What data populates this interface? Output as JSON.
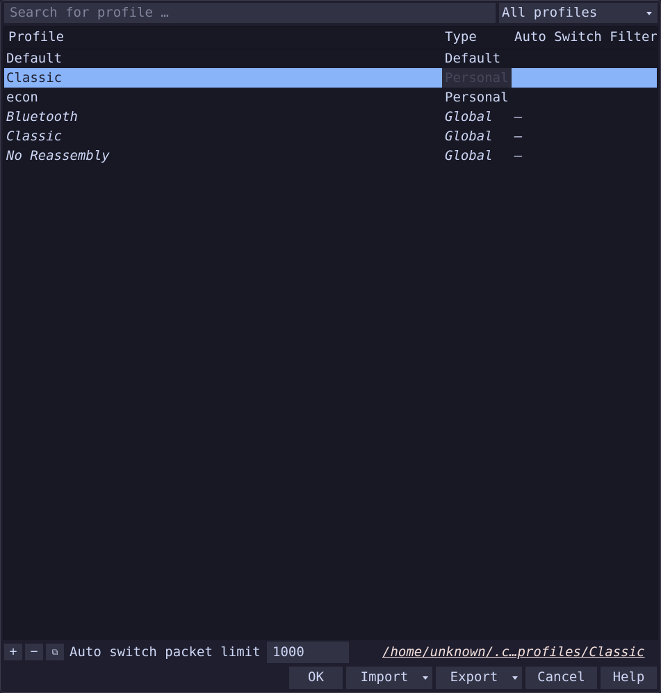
{
  "search": {
    "placeholder": "Search for profile …"
  },
  "filter_combo": {
    "selected": "All profiles"
  },
  "table": {
    "columns": [
      "Profile",
      "Type",
      "Auto Switch Filter"
    ],
    "rows": [
      {
        "profile": "Default",
        "type": "Default",
        "filter": "",
        "italic": false,
        "selected": false
      },
      {
        "profile": "Classic",
        "type": "Personal",
        "filter": "",
        "italic": false,
        "selected": true
      },
      {
        "profile": "econ",
        "type": "Personal",
        "filter": "",
        "italic": false,
        "selected": false
      },
      {
        "profile": "Bluetooth",
        "type": "Global",
        "filter": "–",
        "italic": true,
        "selected": false
      },
      {
        "profile": "Classic",
        "type": "Global",
        "filter": "–",
        "italic": true,
        "selected": false
      },
      {
        "profile": "No Reassembly",
        "type": "Global",
        "filter": "–",
        "italic": true,
        "selected": false
      }
    ]
  },
  "bottom": {
    "add_icon": "+",
    "remove_icon": "−",
    "copy_icon": "⧉",
    "limit_label": "Auto switch packet limit",
    "limit_value": "1000",
    "path": "/home/unknown/.c…profiles/Classic"
  },
  "buttons": {
    "ok": "OK",
    "import": "Import",
    "export": "Export",
    "cancel": "Cancel",
    "help": "Help"
  },
  "colors": {
    "background": "#1e1e2e",
    "selection": "#89b4fa",
    "field": "#313244"
  }
}
